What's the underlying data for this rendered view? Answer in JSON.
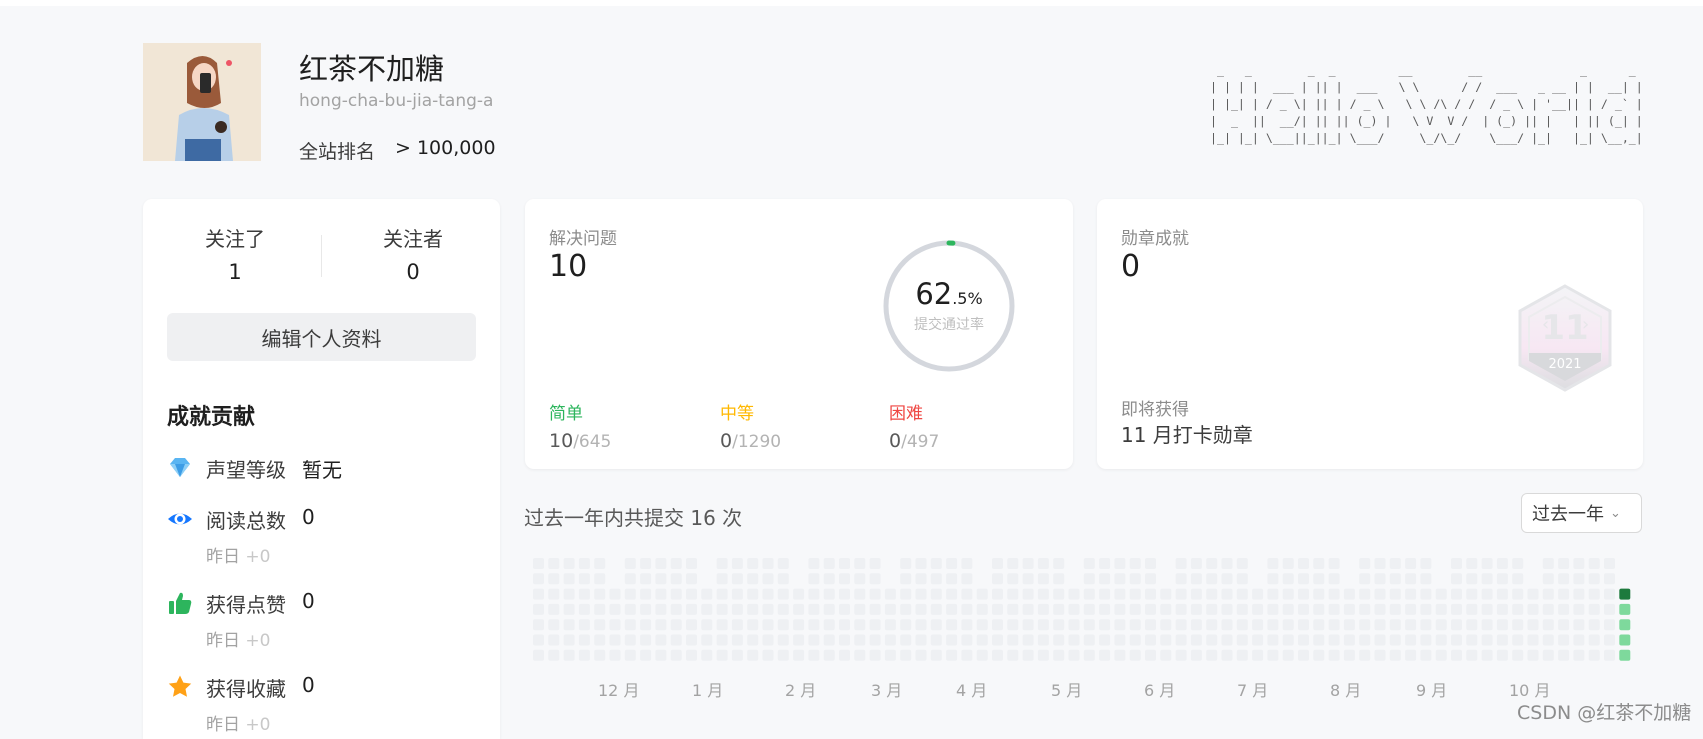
{
  "profile": {
    "username": "红茶不加糖",
    "handle": "hong-cha-bu-jia-tang-a",
    "rank_label": "全站排名",
    "rank_value": "> 100,000",
    "banner_text": " _   _        _  _         __        __              _      _ \n| | | |  ___ | || |  ___   \\ \\      / /  ___   _ __ | |  __| |\n| |_| | / _ \\| || | / _ \\   \\ \\ /\\ / /  / _ \\ | '__|| | / _` |\n|  _  ||  __/| || || (_) |   \\ V  V /  | (_) || |   | || (_| |\n|_| |_| \\___||_||_| \\___/     \\_/\\_/    \\___/ |_|   |_| \\__,_|"
  },
  "follow": {
    "following_label": "关注了",
    "following_count": "1",
    "followers_label": "关注者",
    "followers_count": "0",
    "edit_button": "编辑个人资料"
  },
  "achievements": {
    "title": "成就贡献",
    "items": [
      {
        "icon": "diamond-icon",
        "label": "声望等级",
        "value": "暂无",
        "sub": "",
        "sub_inc": "",
        "color": "#5ab5f2"
      },
      {
        "icon": "eye-icon",
        "label": "阅读总数",
        "value": "0",
        "sub": "昨日",
        "sub_inc": "+0",
        "color": "#1677ff"
      },
      {
        "icon": "thumbs-up-icon",
        "label": "获得点赞",
        "value": "0",
        "sub": "昨日",
        "sub_inc": "+0",
        "color": "#2db55d"
      },
      {
        "icon": "star-icon",
        "label": "获得收藏",
        "value": "0",
        "sub": "昨日",
        "sub_inc": "+0",
        "color": "#ffa116"
      }
    ]
  },
  "solved": {
    "label": "解决问题",
    "count": "10",
    "acceptance_main": "62",
    "acceptance_decimal": ".5%",
    "acceptance_fraction": 0.625,
    "acceptance_label": "提交通过率",
    "difficulties": [
      {
        "name": "简单",
        "solved": "10",
        "total": "645",
        "color": "#2db55d"
      },
      {
        "name": "中等",
        "solved": "0",
        "total": "1290",
        "color": "#ffb800"
      },
      {
        "name": "困难",
        "solved": "0",
        "total": "497",
        "color": "#ef4743"
      }
    ]
  },
  "badges": {
    "label": "勋章成就",
    "count": "0",
    "upcoming_label": "即将获得",
    "upcoming_name": "11 月打卡勋章",
    "badge_month": "11",
    "badge_year": "2021"
  },
  "submissions": {
    "summary": "过去一年内共提交 16 次",
    "range": "过去一年",
    "months": [
      "12 月",
      "1 月",
      "2 月",
      "3 月",
      "4 月",
      "5 月",
      "6 月",
      "7 月",
      "8 月",
      "9 月",
      "10 月"
    ],
    "last_week_levels": [
      1,
      3,
      1,
      1,
      1,
      1
    ],
    "colors": {
      "empty": "#eef0f3",
      "level1": "#7ed99c",
      "level3": "#1d7a3d"
    }
  },
  "watermark": "CSDN @红茶不加糖"
}
